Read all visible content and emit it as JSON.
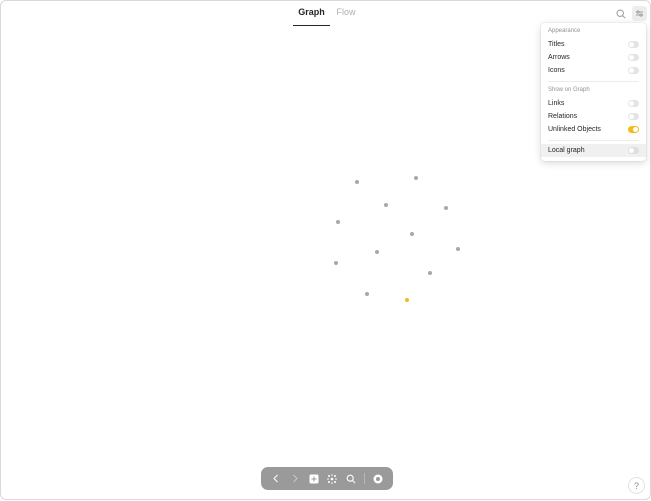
{
  "tabs": {
    "graph": "Graph",
    "flow": "Flow"
  },
  "popup": {
    "appearance_title": "Appearance",
    "appearance": [
      {
        "label": "Titles",
        "on": false
      },
      {
        "label": "Arrows",
        "on": false
      },
      {
        "label": "Icons",
        "on": false
      }
    ],
    "show_title": "Show on Graph",
    "show": [
      {
        "label": "Links",
        "on": false
      },
      {
        "label": "Relations",
        "on": false
      },
      {
        "label": "Unlinked Objects",
        "on": true
      }
    ],
    "local_graph": {
      "label": "Local graph",
      "on": false
    }
  },
  "help": {
    "label": "?"
  },
  "colors": {
    "accent": "#f2bc1b",
    "node": "#a8a8a8",
    "toolbar": "#9a9a9a"
  },
  "icons": {
    "search": "search-icon",
    "filters": "filters-icon",
    "back": "chevron-left-icon",
    "forward": "chevron-right-icon",
    "new": "plus-square-icon",
    "graph": "graph-icon",
    "search_bottom": "search-icon",
    "settings": "circle-menu-icon"
  }
}
